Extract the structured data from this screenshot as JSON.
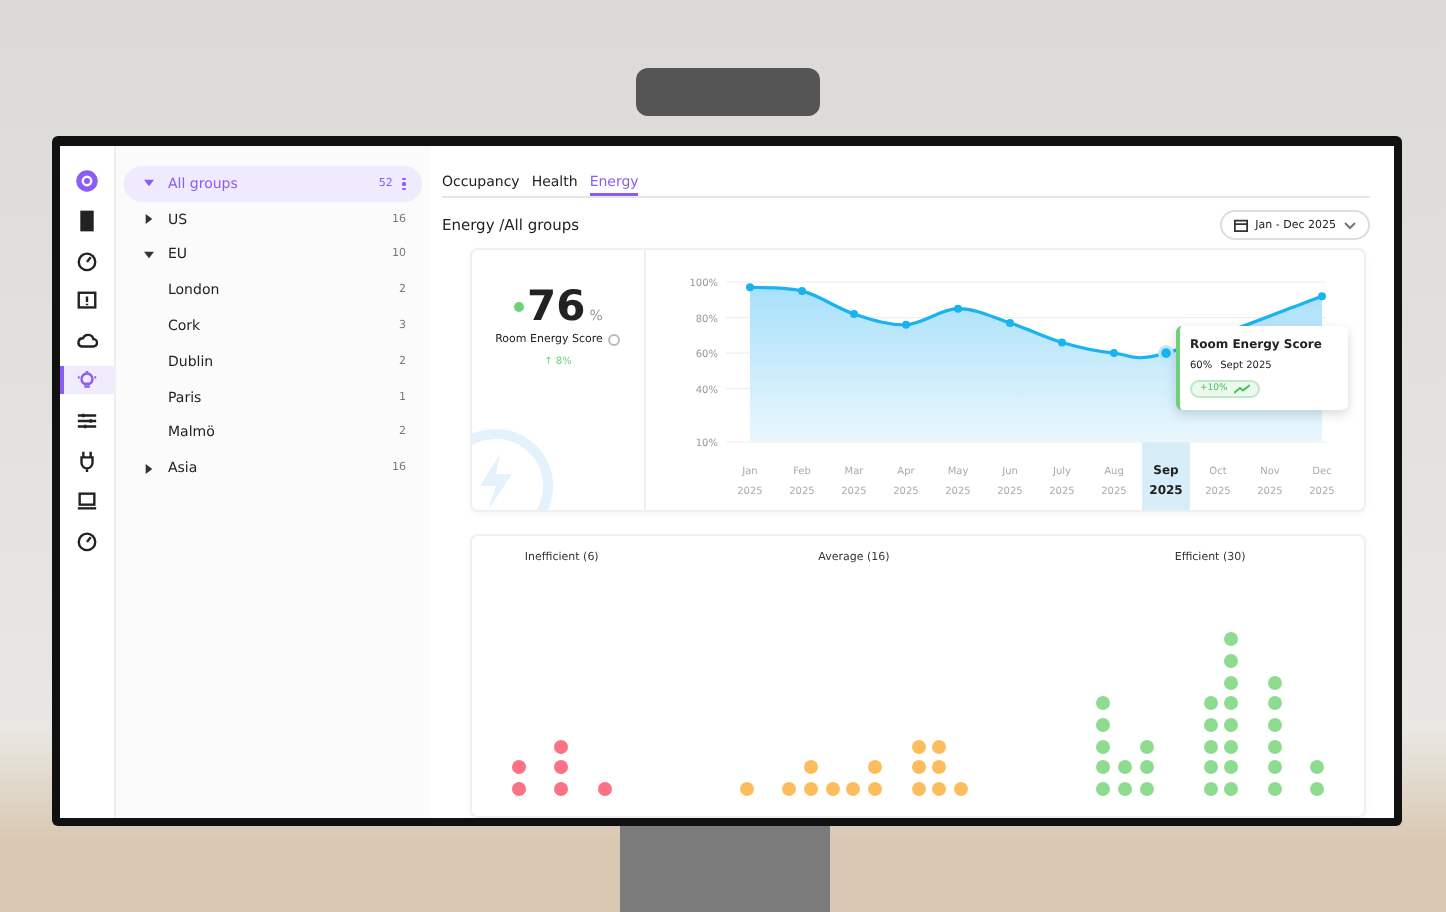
{
  "rail": [
    {
      "kind": "logo",
      "selected": false
    },
    {
      "kind": "door",
      "selected": false
    },
    {
      "kind": "gauge",
      "selected": false
    },
    {
      "kind": "alert",
      "selected": false
    },
    {
      "kind": "cloud",
      "selected": false
    },
    {
      "kind": "bulb",
      "selected": true
    },
    {
      "kind": "sliders",
      "selected": false
    },
    {
      "kind": "plug",
      "selected": false
    },
    {
      "kind": "laptop",
      "selected": false
    },
    {
      "kind": "gauge",
      "selected": false
    }
  ],
  "tree": [
    {
      "label": "All groups",
      "count": "52",
      "expanded": true,
      "selected": true,
      "children": [
        {
          "label": "US",
          "count": "16",
          "expanded": false,
          "selected": false
        },
        {
          "label": "EU",
          "count": "10",
          "expanded": true,
          "selected": false,
          "children": [
            {
              "label": "London",
              "count": "2",
              "selected": false
            },
            {
              "label": "Cork",
              "count": "3",
              "selected": false
            },
            {
              "label": "Dublin",
              "count": "2",
              "selected": false
            },
            {
              "label": "Paris",
              "count": "1",
              "selected": false
            },
            {
              "label": "Malmö",
              "count": "2",
              "selected": false
            }
          ]
        },
        {
          "label": "Asia",
          "count": "16",
          "expanded": false,
          "selected": false
        }
      ]
    }
  ],
  "tabs": [
    {
      "label": "Occupancy",
      "selected": false
    },
    {
      "label": "Health",
      "selected": false
    },
    {
      "label": "Energy",
      "selected": true
    }
  ],
  "title": "Energy /All groups",
  "date_range": "Jan - Dec 2025",
  "score": {
    "value": "76",
    "unit": "%",
    "label": "Room Energy Score",
    "change": "↑ 8%",
    "color": "#6fd27a"
  },
  "energy_chart": {
    "chart_data": {
      "type": "area",
      "categories": [
        "Jan 2025",
        "Feb 2025",
        "Mar 2025",
        "Apr 2025",
        "May 2025",
        "Jun 2025",
        "July 2025",
        "Aug 2025",
        "Sep 2025",
        "Oct 2025",
        "Nov 2025",
        "Dec 2025"
      ],
      "series": [
        {
          "name": "Room Energy Score",
          "color": "#19b3f0",
          "values": [
            97,
            95,
            82,
            76,
            85,
            77,
            66,
            60,
            60,
            null,
            null,
            92
          ]
        }
      ],
      "ylim": [
        10,
        100
      ],
      "yticks": [
        {
          "value": 100,
          "label": "100%"
        },
        {
          "value": 80,
          "label": "80%"
        },
        {
          "value": 60,
          "label": "60%"
        },
        {
          "value": 40,
          "label": "40%"
        },
        {
          "value": 10,
          "label": "10%"
        }
      ],
      "grid": true
    },
    "tooltip": {
      "value": "60%",
      "date": "Sept 2025",
      "change": "+10%"
    }
  },
  "distribution": [
    {
      "label": "Inefficient (6)",
      "color": "#fb7185"
    },
    {
      "label": "Average (16)",
      "color": "#fdbd5c"
    },
    {
      "label": "Efficient (30)",
      "color": "#8ddc8f"
    }
  ]
}
